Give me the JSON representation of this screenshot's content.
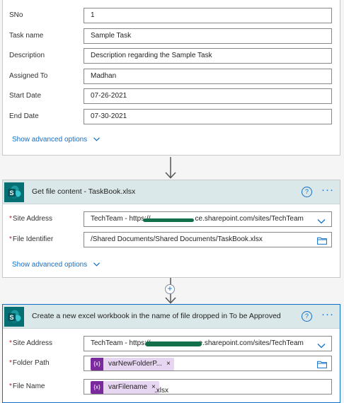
{
  "card1": {
    "fields": [
      {
        "label": "SNo",
        "value": "1"
      },
      {
        "label": "Task name",
        "value": "Sample Task"
      },
      {
        "label": "Description",
        "value": "Description regarding the Sample Task"
      },
      {
        "label": "Assigned To",
        "value": "Madhan"
      },
      {
        "label": "Start Date",
        "value": "07-26-2021"
      },
      {
        "label": "End Date",
        "value": "07-30-2021"
      }
    ],
    "show_advanced": "Show advanced options"
  },
  "card2": {
    "title": "Get file content - TaskBook.xlsx",
    "site_label": "Site Address",
    "site_value_prefix": "TechTeam - https://",
    "site_value_suffix": "ce.sharepoint.com/sites/TechTeam",
    "file_label": "File Identifier",
    "file_value": "/Shared Documents/Shared Documents/TaskBook.xlsx",
    "show_advanced": "Show advanced options",
    "help": "?",
    "more": "···"
  },
  "card3": {
    "title": "Create a new excel workbook in the name of file dropped in To be Approved",
    "site_label": "Site Address",
    "site_value_prefix": "TechTeam - https://",
    "site_value_suffix": "e.sharepoint.com/sites/TechTeam",
    "folder_label": "Folder Path",
    "folder_token": "varNewFolderP...",
    "file_label": "File Name",
    "file_token": "varFilename",
    "file_suffix": ".xlsx",
    "token_symbol": "{x}",
    "token_remove": "×",
    "help": "?",
    "more": "···"
  },
  "required_mark": "*",
  "colors": {
    "accent": "#0f6fc6",
    "header_bg": "#dbe8e9",
    "sharepoint": "#056f73",
    "token_bg": "#e7d6f2",
    "token_icon": "#7a2a9c",
    "required": "#a4262c"
  },
  "icons": {
    "sharepoint": "sharepoint-icon",
    "help": "help-icon",
    "more": "more-icon",
    "dropdown": "chevron-down-icon",
    "folder": "folder-icon",
    "arrow": "arrow-down-icon",
    "add": "plus-icon"
  }
}
